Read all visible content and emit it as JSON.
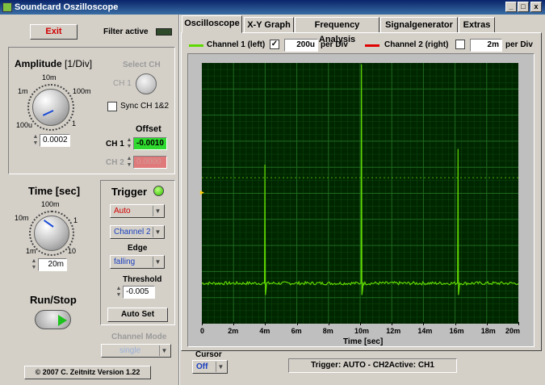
{
  "window": {
    "title": "Soundcard Oszilloscope",
    "btn_min": "_",
    "btn_max": "□",
    "btn_close": "x"
  },
  "top": {
    "exit_label": "Exit",
    "filter_label": "Filter active"
  },
  "amplitude": {
    "title": "Amplitude",
    "unit": "[1/Div]",
    "knob_labels": [
      "10m",
      "1m",
      "100m",
      "100u",
      "1"
    ],
    "value": "0.0002",
    "select_ch_title": "Select CH",
    "select_ch_label": "CH 1",
    "sync_label": "Sync CH 1&2",
    "offset_title": "Offset",
    "ch1_label": "CH 1",
    "ch1_offset": "-0.0010",
    "ch2_label": "CH 2",
    "ch2_offset": "0.0000"
  },
  "time": {
    "title": "Time [sec]",
    "knob_labels": [
      "100m",
      "10m",
      "1",
      "1m",
      "10"
    ],
    "value": "20m"
  },
  "run": {
    "title": "Run/Stop"
  },
  "trigger": {
    "title": "Trigger",
    "mode": "Auto",
    "source": "Channel 2",
    "edge_label": "Edge",
    "edge": "falling",
    "threshold_label": "Threshold",
    "threshold": "-0.005",
    "autoset_label": "Auto Set"
  },
  "channel_mode": {
    "label": "Channel Mode",
    "value": "single"
  },
  "footer": {
    "copyright": "© 2007  C. Zeitnitz Version 1.22"
  },
  "tabs": [
    {
      "label": "Oscilloscope",
      "active": true
    },
    {
      "label": "X-Y Graph",
      "active": false
    },
    {
      "label": "Frequency Analysis",
      "active": false
    },
    {
      "label": "Signalgenerator",
      "active": false
    },
    {
      "label": "Extras",
      "active": false
    }
  ],
  "channels": {
    "ch1_label": "Channel 1 (left)",
    "ch1_color": "#5fd800",
    "ch1_checked": "✓",
    "ch1_per_div": "200u",
    "ch2_label": "Channel 2 (right)",
    "ch2_color": "#e00000",
    "ch2_per_div": "2m",
    "per_div_label": "per Div"
  },
  "cursor": {
    "label": "Cursor",
    "value": "Off"
  },
  "status": "Trigger: AUTO - CH2Active: CH1",
  "chart_data": {
    "type": "line",
    "xlabel": "Time [sec]",
    "ylabel": "",
    "x_tick_labels": [
      "0",
      "2m",
      "4m",
      "6m",
      "8m",
      "10m",
      "12m",
      "14m",
      "16m",
      "18m",
      "20m"
    ],
    "xlim": [
      0,
      0.02
    ],
    "ylim": [
      -5,
      5
    ],
    "grid": true,
    "trigger_level_y": 0.6,
    "series": [
      {
        "color": "#5fd800",
        "baseline_y": -3.45,
        "spikes": [
          {
            "x": 0.004,
            "y_peak": 1.1,
            "y_dip": -3.9
          },
          {
            "x": 0.0101,
            "y_peak": 4.95,
            "y_dip": -3.9
          },
          {
            "x": 0.0162,
            "y_peak": 1.7,
            "y_dip": -3.9
          }
        ]
      }
    ]
  }
}
